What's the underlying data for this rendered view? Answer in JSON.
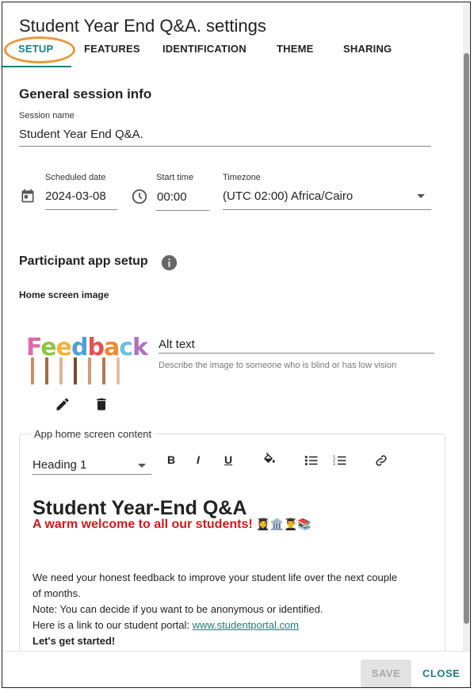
{
  "dialog": {
    "title": "Student Year End Q&A. settings"
  },
  "tabs": [
    {
      "label": "SETUP"
    },
    {
      "label": "FEATURES"
    },
    {
      "label": "IDENTIFICATION"
    },
    {
      "label": "THEME"
    },
    {
      "label": "SHARING"
    }
  ],
  "general": {
    "heading": "General session info",
    "session_name_label": "Session name",
    "session_name_value": "Student Year End Q&A.",
    "scheduled_date_label": "Scheduled date",
    "scheduled_date_value": "2024-03-08",
    "start_time_label": "Start time",
    "start_time_value": "00:00",
    "timezone_label": "Timezone",
    "timezone_value": "(UTC 02:00) Africa/Cairo"
  },
  "participant": {
    "heading": "Participant app setup",
    "home_image_label": "Home screen image",
    "image_word": "Feedback",
    "alt_text_label": "Alt text",
    "alt_text_helper": "Describe the image to someone who is blind or has low vision"
  },
  "editor": {
    "legend": "App home screen content",
    "format_value": "Heading 1",
    "toolbar": {
      "bold": "B",
      "italic": "I",
      "underline": "U"
    },
    "content": {
      "h1": "Student Year-End Q&A",
      "welcome": "A warm welcome to all our students!",
      "emojis": "👩‍🎓🏛️👨‍🎓📚",
      "p1": "We need your honest feedback to improve your student life over the next couple",
      "p1b": "of months.",
      "p2": "Note: You can decide if you want to be anonymous or identified.",
      "p3_prefix": "Here is a link to our student portal: ",
      "p3_link": "www.studentportal.com",
      "p4": "Let's get started!"
    }
  },
  "footer": {
    "save_label": "SAVE",
    "close_label": "CLOSE"
  },
  "colors": {
    "accent": "#1a7f7f",
    "highlight_ring": "#e79a3a",
    "welcome_red": "#d11a1a"
  }
}
